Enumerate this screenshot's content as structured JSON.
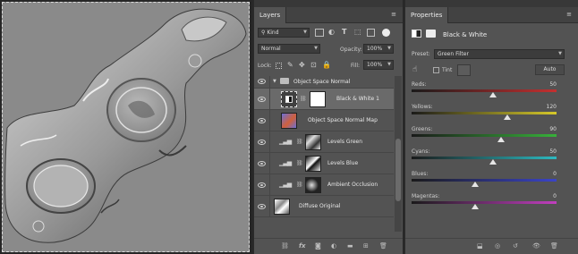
{
  "layers_panel": {
    "tab": "Layers",
    "filter_kind": "Kind",
    "blend_mode": "Normal",
    "opacity_label": "Opacity:",
    "opacity_value": "100%",
    "fill_label": "Fill:",
    "fill_value": "100%",
    "lock_label": "Lock:",
    "group_name": "Object Space Normal",
    "layers": [
      {
        "name": "Black & White 1",
        "selected": true
      },
      {
        "name": "Object Space Normal Map",
        "selected": false
      },
      {
        "name": "Levels Green",
        "selected": false
      },
      {
        "name": "Levels Blue",
        "selected": false
      },
      {
        "name": "Ambient Occlusion",
        "selected": false
      },
      {
        "name": "Diffuse Original",
        "selected": false
      }
    ],
    "fx_label": "fx"
  },
  "properties_panel": {
    "tab": "Properties",
    "title": "Black & White",
    "preset_label": "Preset:",
    "preset_value": "Green Filter",
    "tint_label": "Tint",
    "auto_label": "Auto",
    "sliders": [
      {
        "label": "Reds:",
        "value": "50",
        "fraction": 0.56,
        "gradient": "linear-gradient(90deg,#1a1a1a,#c43030)"
      },
      {
        "label": "Yellows:",
        "value": "120",
        "fraction": 0.66,
        "gradient": "linear-gradient(90deg,#1a1a1a,#d6c82a)"
      },
      {
        "label": "Greens:",
        "value": "90",
        "fraction": 0.62,
        "gradient": "linear-gradient(90deg,#1a1a1a,#37b03a)"
      },
      {
        "label": "Cyans:",
        "value": "50",
        "fraction": 0.56,
        "gradient": "linear-gradient(90deg,#1a1a1a,#2db9c0)"
      },
      {
        "label": "Blues:",
        "value": "0",
        "fraction": 0.44,
        "gradient": "linear-gradient(90deg,#1a1a1a,#3a44c8)"
      },
      {
        "label": "Magentas:",
        "value": "0",
        "fraction": 0.44,
        "gradient": "linear-gradient(90deg,#1a1a1a,#c13fbf)"
      }
    ]
  },
  "colors": {
    "panel_bg": "#535353",
    "selected_row": "#6a6a6a",
    "canvas_bg": "#8a8a8a"
  }
}
